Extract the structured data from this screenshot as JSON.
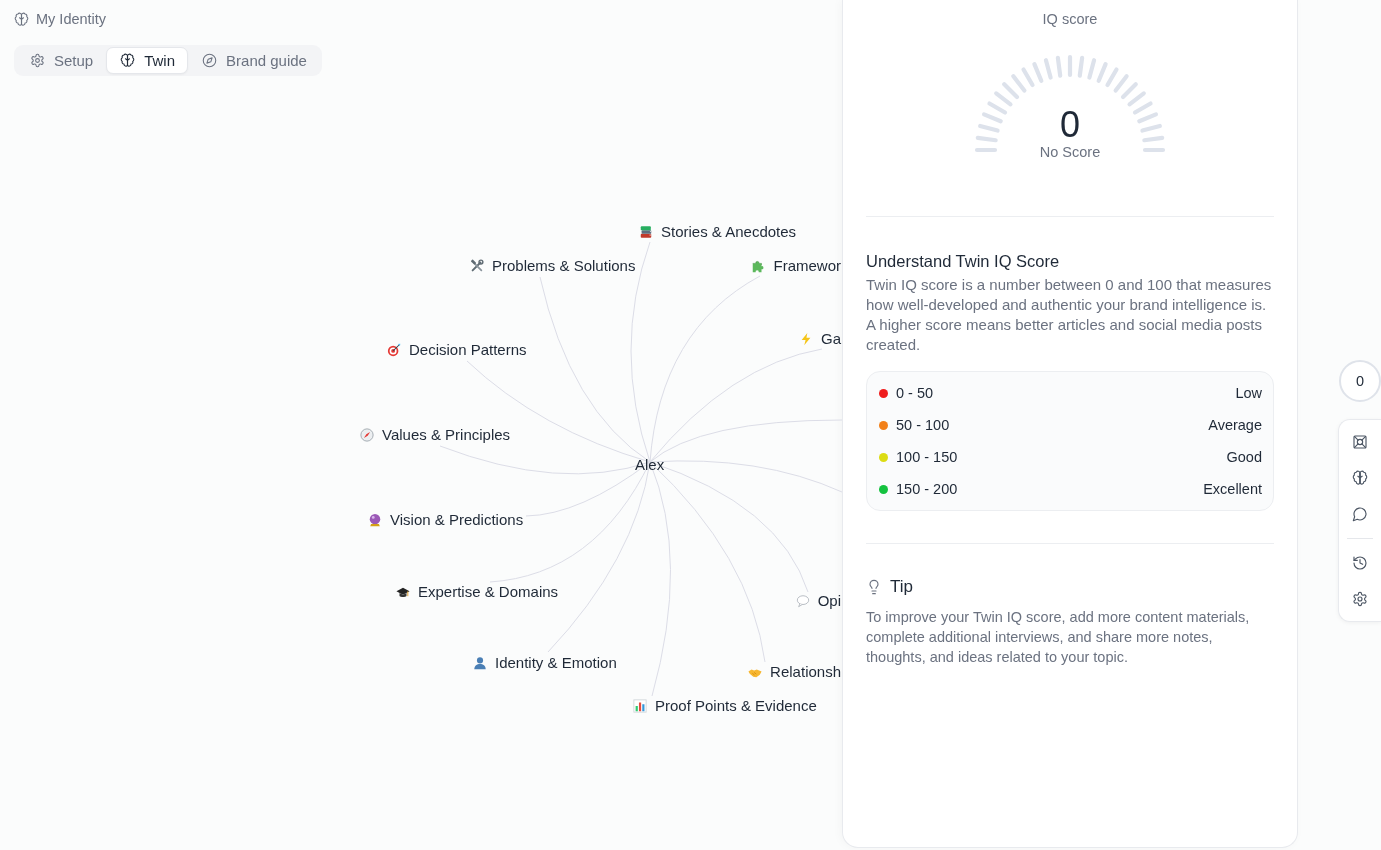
{
  "page_title": "My Identity",
  "tabs": [
    {
      "label": "Setup",
      "selected": false
    },
    {
      "label": "Twin",
      "selected": true
    },
    {
      "label": "Brand guide",
      "selected": false
    }
  ],
  "graph": {
    "center": "Alex",
    "nodes": [
      {
        "label": "Stories & Anecdotes"
      },
      {
        "label": "Problems & Solutions"
      },
      {
        "label": "Framewor"
      },
      {
        "label": "Ga"
      },
      {
        "label": "Decision Patterns"
      },
      {
        "label": "Values & Principles"
      },
      {
        "label": "Vision & Predictions"
      },
      {
        "label": "Expertise & Domains"
      },
      {
        "label": "Opi"
      },
      {
        "label": "Identity & Emotion"
      },
      {
        "label": "Relationsh"
      },
      {
        "label": "Proof Points & Evidence"
      }
    ]
  },
  "iq_panel": {
    "title": "IQ score",
    "gauge": {
      "value": "0",
      "caption": "No Score"
    },
    "heading": "Understand Twin IQ Score",
    "description": "Twin IQ score is a number between 0 and 100 that measures how well-developed and authentic your brand intelligence is. A higher score means better articles and social media posts created.",
    "ranges": [
      {
        "range": "0 - 50",
        "label": "Low",
        "color": "#ef1d1d"
      },
      {
        "range": "50 - 100",
        "label": "Average",
        "color": "#f28019"
      },
      {
        "range": "100 - 150",
        "label": "Good",
        "color": "#dcdc14"
      },
      {
        "range": "150 - 200",
        "label": "Excellent",
        "color": "#14c23f"
      }
    ],
    "tip": {
      "title": "Tip",
      "text": "To improve your Twin IQ score, add more content materials, complete additional interviews, and share more notes, thoughts, and ideas related to your topic."
    }
  },
  "rail": {
    "score": "0"
  }
}
